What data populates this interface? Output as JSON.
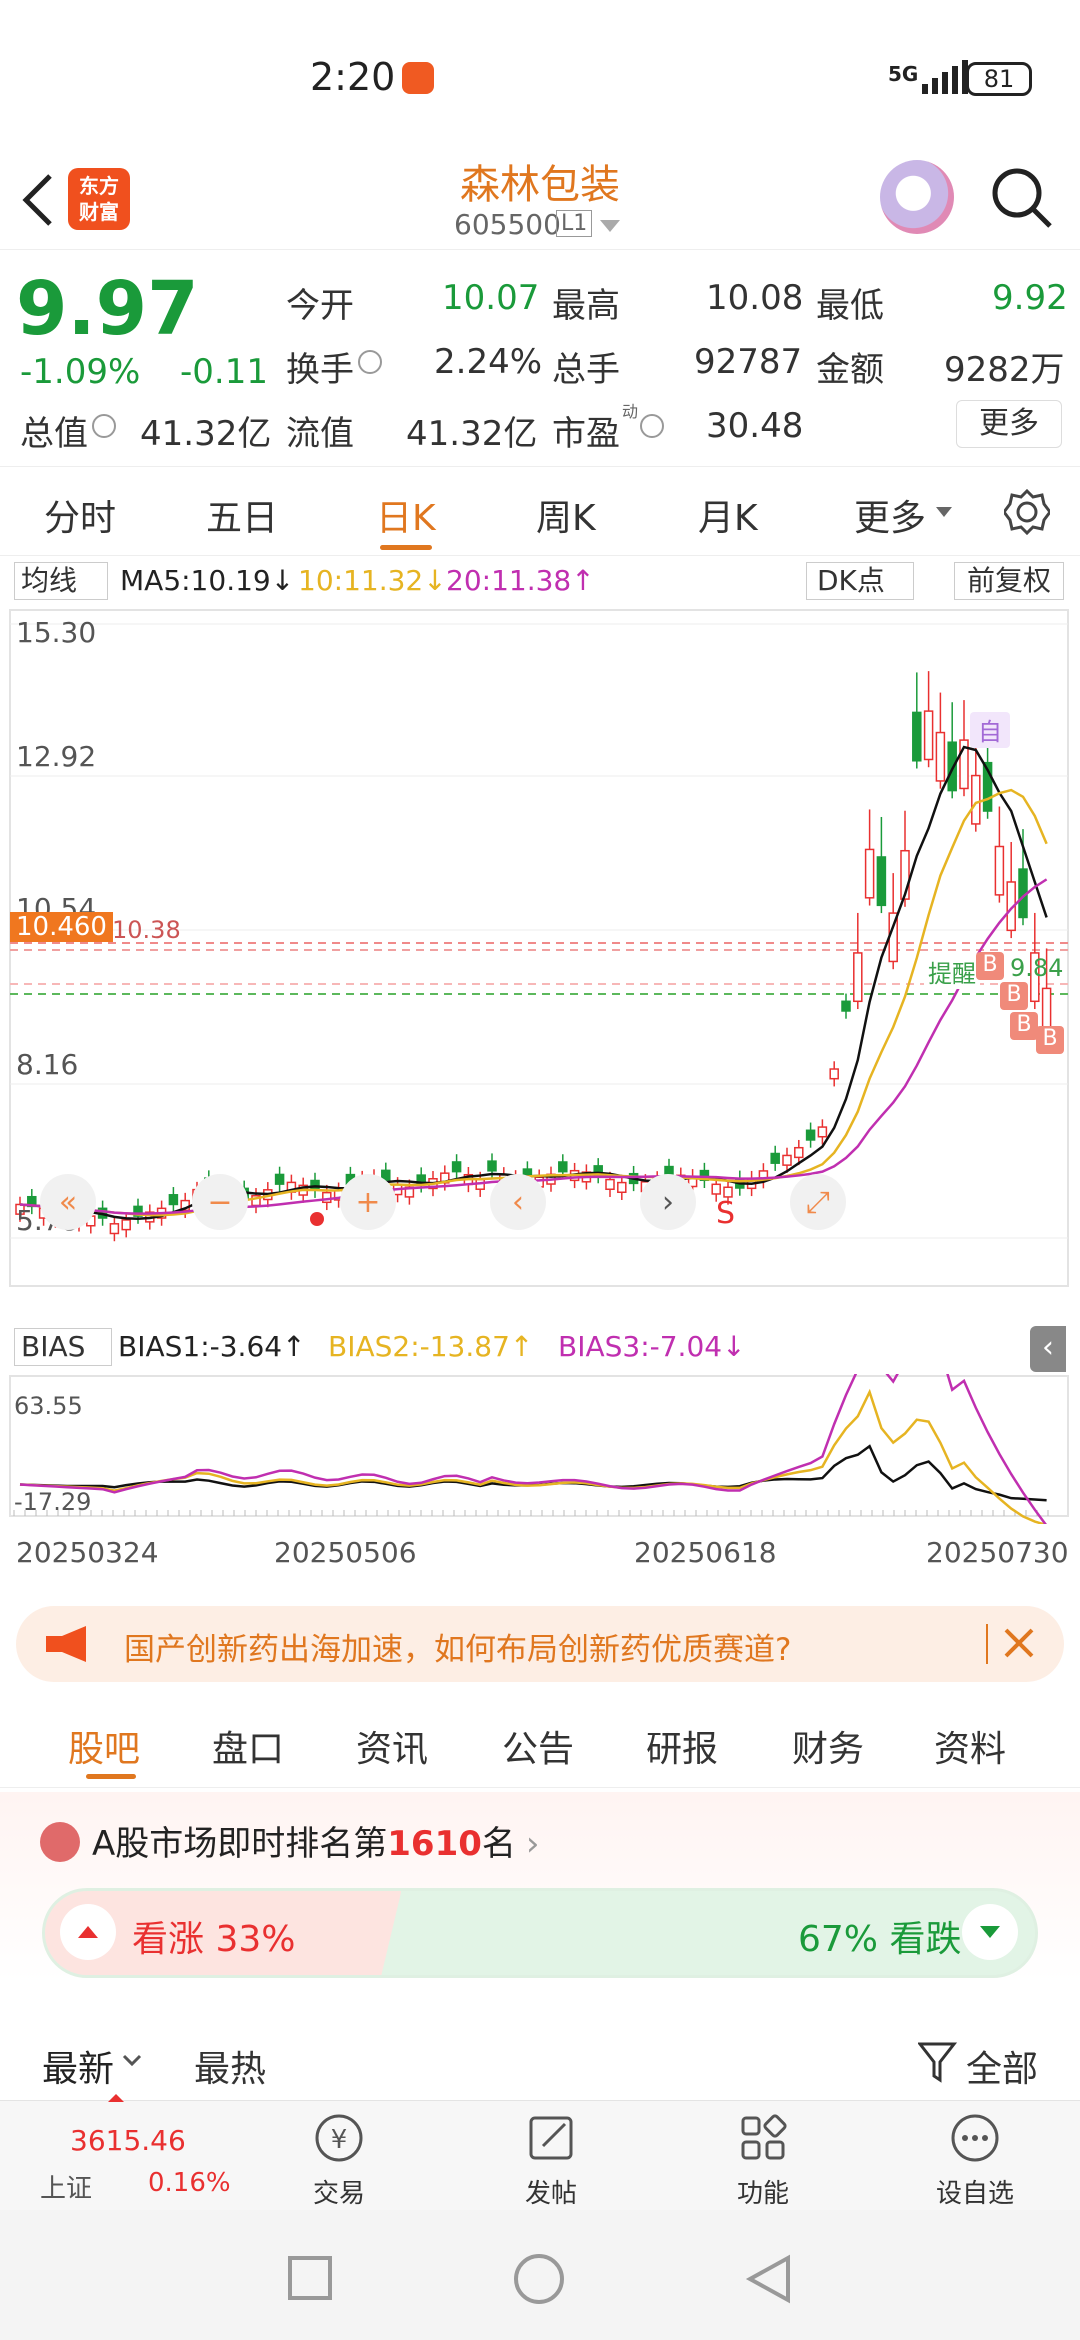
{
  "status": {
    "time": "2:20",
    "network": "5G",
    "battery": "81"
  },
  "header": {
    "logo": "东方\n财富",
    "name": "森林包装",
    "code": "605500",
    "code_tag": "L1"
  },
  "quote": {
    "price": "9.97",
    "change_pct": "-1.09%",
    "change": "-0.11",
    "open_label": "今开",
    "open": "10.07",
    "high_label": "最高",
    "high": "10.08",
    "low_label": "最低",
    "low": "9.92",
    "turnover_label": "换手",
    "turnover": "2.24%",
    "volume_label": "总手",
    "volume": "92787",
    "amount_label": "金额",
    "amount": "9282万",
    "mktcap_label": "总值",
    "mktcap": "41.32亿",
    "float_label": "流值",
    "float": "41.32亿",
    "pe_label": "市盈",
    "pe_sup": "动",
    "pe": "30.48",
    "more": "更多"
  },
  "tabs": {
    "items": [
      "分时",
      "五日",
      "日K",
      "周K",
      "月K",
      "更多"
    ],
    "active": 2
  },
  "chart": {
    "ma_selector": "均线",
    "ma5": "MA5:10.19↓",
    "ma10": "10:11.32↓",
    "ma20": "20:11.38↑",
    "dk": "DK点",
    "fq": "前复权",
    "y_top": "15.30",
    "y_2": "12.92",
    "y_3": "10.54",
    "y_4": "8.16",
    "y_bottom": "5.78",
    "price_tag": "10.460",
    "ref_price": "10.38",
    "remind": "提醒",
    "remind_price": "9.84",
    "self_mark": "自",
    "b_mark": "B",
    "s_mark": "S",
    "bias_selector": "BIAS",
    "bias1": "BIAS1:-3.64↑",
    "bias2": "BIAS2:-13.87↑",
    "bias3": "BIAS3:-7.04↓",
    "bias_top": "63.55",
    "bias_bottom": "-17.29",
    "dates": [
      "20250324",
      "20250506",
      "20250618",
      "20250730"
    ],
    "colors": {
      "ma5": "#111111",
      "ma10": "#e6b422",
      "ma20": "#c02fb0",
      "up": "#e93030",
      "down": "#1a9a3a"
    }
  },
  "banner": {
    "text": "国产创新药出海加速，如何布局创新药优质赛道?"
  },
  "section_tabs": {
    "items": [
      "股吧",
      "盘口",
      "资讯",
      "公告",
      "研报",
      "财务",
      "资料"
    ],
    "active": 0
  },
  "rank": {
    "prefix": "A股市场即时排名第",
    "number": "1610",
    "suffix": "名"
  },
  "vote": {
    "up_label": "看涨 33%",
    "down_label": "67% 看跌",
    "up_pct": 0.33
  },
  "sort": {
    "latest": "最新",
    "hot": "最热",
    "filter": "全部"
  },
  "bottom_nav": {
    "index_value": "3615.46",
    "index_name": "上证",
    "index_change": "0.16%",
    "items": [
      "交易",
      "发帖",
      "功能",
      "设自选"
    ]
  }
}
